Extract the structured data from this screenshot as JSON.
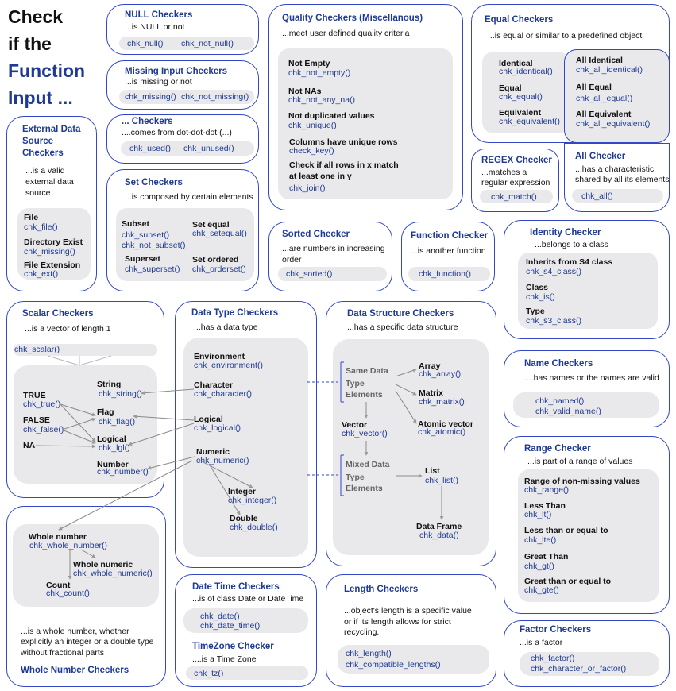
{
  "title": {
    "l1": "Check",
    "l2": "if the",
    "l3": "Function",
    "l4": "Input ..."
  },
  "null": {
    "h": "NULL Checkers",
    "d": "...is NULL or not",
    "f1": "chk_null()",
    "f2": "chk_not_null()"
  },
  "missing": {
    "h": "Missing Input Checkers",
    "d": "...is missing or not",
    "f1": "chk_missing()",
    "f2": "chk_not_missing()"
  },
  "dots": {
    "h": "... Checkers",
    "d": "....comes from dot-dot-dot (...)",
    "f1": "chk_used()",
    "f2": "chk_unused()"
  },
  "ext": {
    "h1": "External Data",
    "h2": "Source",
    "h3": "Checkers",
    "d1": "...is a valid",
    "d2": "external data",
    "d3": "source",
    "b1": "File",
    "f1": "chk_file()",
    "b2": "Directory Exist",
    "f2": "chk_missing()",
    "b3": "File Extension",
    "f3": "chk_ext()"
  },
  "set": {
    "h": "Set Checkers",
    "d": "...is composed by certain elements",
    "b1": "Subset",
    "f1a": "chk_subset()",
    "f1b": "chk_not_subset()",
    "b2": "Set equal",
    "f2": "chk_setequal()",
    "b3": "Superset",
    "f3": "chk_superset()",
    "b4": "Set ordered",
    "f4": "chk_orderset()"
  },
  "quality": {
    "h": "Quality Checkers (Miscellanous)",
    "d": "...meet user defined quality criteria",
    "b1": "Not Empty",
    "f1": "chk_not_empty()",
    "b2": "Not NAs",
    "f2": "chk_not_any_na()",
    "b3": "Not duplicated values",
    "f3": "chk_unique()",
    "b4": "Columns have unique rows",
    "f4": "check_key()",
    "b5a": "Check if all rows in x match",
    "b5b": "at least one in y",
    "f5": "chk_join()"
  },
  "equal": {
    "h": "Equal Checkers",
    "d": "...is equal or similar to a predefined object",
    "b1": "Identical",
    "f1": "chk_identical()",
    "b2": "Equal",
    "f2": "chk_equal()",
    "b3": "Equivalent",
    "f3": "chk_equivalent()",
    "b4": "All Identical",
    "f4": "chk_all_identical()",
    "b5": "All Equal",
    "f5": "chk_all_equal()",
    "b6": "All Equivalent",
    "f6": "chk_all_equivalent()"
  },
  "regex": {
    "h": "REGEX Checker",
    "d1": "...matches a",
    "d2": "regular expression",
    "f": "chk_match()"
  },
  "allck": {
    "h": "All Checker",
    "d1": "...has a characteristic",
    "d2": "shared by all its elements",
    "f": "chk_all()"
  },
  "sorted": {
    "h": "Sorted Checker",
    "d1": "...are numbers in increasing",
    "d2": "order",
    "f": "chk_sorted()"
  },
  "func": {
    "h": "Function Checker",
    "d": "...is another function",
    "f": "chk_function()"
  },
  "identity": {
    "h": "Identity Checker",
    "d": "...belongs to a class",
    "b1": "Inherits from S4 class",
    "f1": "chk_s4_class()",
    "b2": "Class",
    "f2": "chk_is()",
    "b3": "Type",
    "f3": "chk_s3_class()"
  },
  "scalar": {
    "h": "Scalar Checkers",
    "d": "...is a vector of length 1",
    "f0": "chk_scalar()",
    "b_str": "String",
    "f_str": "chk_string()",
    "b_true": "TRUE",
    "f_true": "chk_true()",
    "b_flag": "Flag",
    "f_flag": "chk_flag()",
    "b_false": "FALSE",
    "f_false": "chk_false()",
    "b_lgl": "Logical",
    "f_lgl": "chk_lgl()",
    "b_na": "NA",
    "b_num": "Number",
    "f_num": "chk_number()"
  },
  "whole": {
    "b1": "Whole number",
    "f1": "chk_whole_number()",
    "b2": "Whole numeric",
    "f2": "chk_whole_numeric()",
    "b3": "Count",
    "f3": "chk_count()",
    "d1": "...is a whole number, whether",
    "d2": "explicitly an integer or a double type",
    "d3": "without fractional parts",
    "h": "Whole Number Checkers"
  },
  "dtype": {
    "h": "Data Type Checkers",
    "d": "...has a data type",
    "b1": "Environment",
    "f1": "chk_environment()",
    "b2": "Character",
    "f2": "chk_character()",
    "b3": "Logical",
    "f3": "chk_logical()",
    "b4": "Numeric",
    "f4": "chk_numeric()",
    "b5": "Integer",
    "f5": "chk_integer()",
    "b6": "Double",
    "f6": "chk_double()"
  },
  "dstruct": {
    "h": "Data Structure Checkers",
    "d": "...has a specific data structure",
    "same1": "Same Data",
    "same2": "Type",
    "same3": "Elements",
    "mixed1": "Mixed Data",
    "mixed2": "Type",
    "mixed3": "Elements",
    "b_arr": "Array",
    "f_arr": "chk_array()",
    "b_mat": "Matrix",
    "f_mat": "chk_matrix()",
    "b_vec": "Vector",
    "f_vec": "chk_vector()",
    "b_atom": "Atomic vector",
    "f_atom": "chk_atomic()",
    "b_list": "List",
    "f_list": "chk_list()",
    "b_df": "Data Frame",
    "f_df": "chk_data()"
  },
  "name": {
    "h": "Name Checkers",
    "d": "....has names or the names are valid",
    "f1": "chk_named()",
    "f2": "chk_valid_name()"
  },
  "range": {
    "h": "Range Checker",
    "d": "...is part of a range of values",
    "b1": "Range of non-missing values",
    "f1": "chk_range()",
    "b2": "Less Than",
    "f2": "chk_lt()",
    "b3": "Less than or equal to",
    "f3": "chk_lte()",
    "b4": "Great Than",
    "f4": "chk_gt()",
    "b5": "Great than or equal to",
    "f5": "chk_gte()"
  },
  "datetime": {
    "h": "Date Time Checkers",
    "d": "...is of class Date or DateTime",
    "f1": "chk_date()",
    "f2": "chk_date_time()",
    "h2": "TimeZone Checker",
    "d2": "....is a Time Zone",
    "f3": "chk_tz()"
  },
  "length": {
    "h": "Length Checkers",
    "d1": "...object's length is a specific value",
    "d2": "or if its length allows for strict",
    "d3": "recycling.",
    "f1": "chk_length()",
    "f2": "chk_compatible_lengths()"
  },
  "factor": {
    "h": "Factor Checkers",
    "d": "...is a factor",
    "f1": "chk_factor()",
    "f2": "chk_character_or_factor()"
  }
}
